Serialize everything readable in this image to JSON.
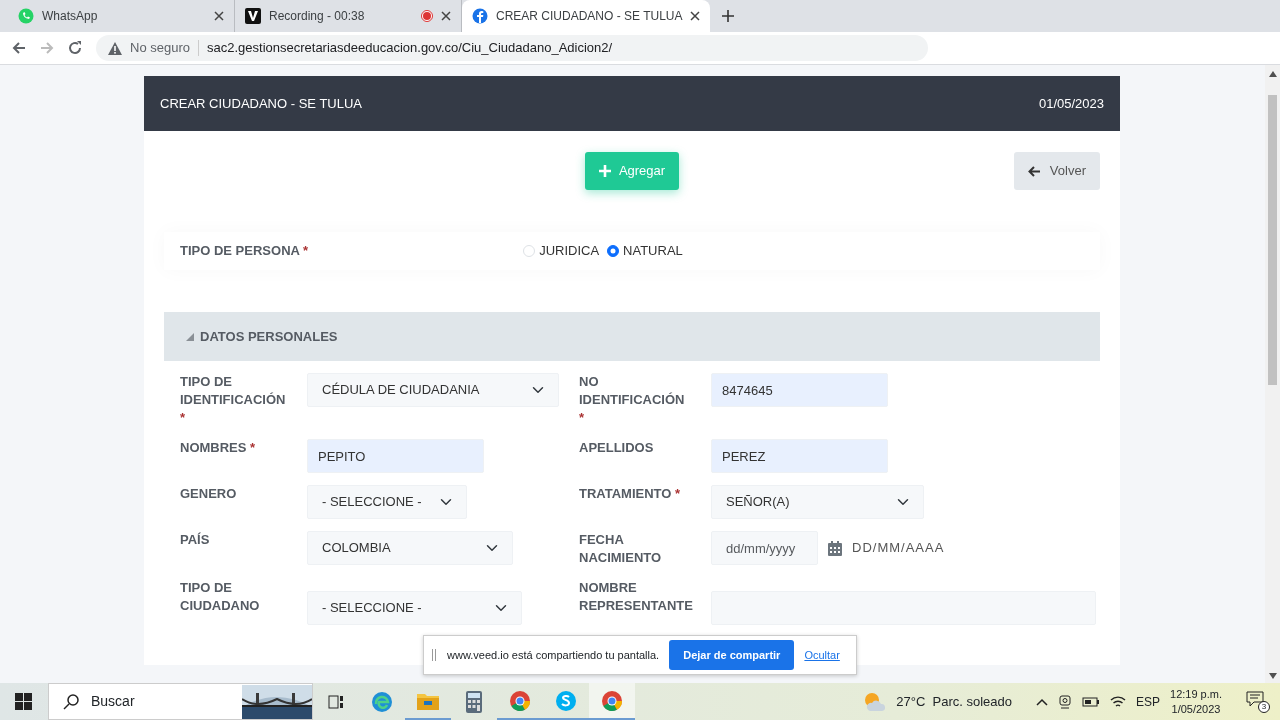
{
  "browser": {
    "tabs": [
      {
        "label": "WhatsApp",
        "selected": false,
        "kind": "whatsapp",
        "recording": false
      },
      {
        "label": "Recording - 00:38",
        "selected": false,
        "kind": "v",
        "recording": true
      },
      {
        "label": "CREAR CIUDADANO - SE TULUA",
        "selected": true,
        "kind": "site",
        "recording": false
      }
    ],
    "security": "No seguro",
    "url": "sac2.gestionsecretariasdeeducacion.gov.co/Ciu_Ciudadano_Adicion2/"
  },
  "header": {
    "title": "CREAR CIUDADANO - SE TULUA",
    "date": "01/05/2023"
  },
  "buttons": {
    "add": "Agregar",
    "back": "Volver"
  },
  "persona": {
    "label": "TIPO DE PERSONA",
    "required_mark": "*",
    "options": [
      {
        "label": "JURIDICA",
        "selected": false
      },
      {
        "label": "NATURAL",
        "selected": true
      }
    ]
  },
  "section": {
    "title": "DATOS PERSONALES",
    "expanded": true
  },
  "fields": [
    {
      "label": "TIPO DE IDENTIFICACIÓN",
      "required_mark": "*",
      "kind": "select",
      "value": "CÉDULA DE CIUDADANIA"
    },
    {
      "label": "NO IDENTIFICACIÓN",
      "required_mark": "*",
      "kind": "input",
      "value": "8474645",
      "filled": true
    },
    {
      "label": "NOMBRES",
      "required_mark": "*",
      "kind": "input",
      "value": "PEPITO",
      "filled": true
    },
    {
      "label": "APELLIDOS",
      "kind": "input",
      "value": "PEREZ",
      "filled": true
    },
    {
      "label": "GENERO",
      "kind": "select",
      "value": "- SELECCIONE -"
    },
    {
      "label": "TRATAMIENTO",
      "required_mark": "*",
      "kind": "select",
      "value": "SEÑOR(A)"
    },
    {
      "label": "PAÍS",
      "kind": "select",
      "value": "COLOMBIA"
    },
    {
      "label": "FECHA NACIMIENTO",
      "kind": "date",
      "placeholder": "dd/mm/yyyy",
      "hint": "DD/MM/AAAA"
    },
    {
      "label": "TIPO DE CIUDADANO",
      "kind": "select",
      "value": "- SELECCIONE -"
    },
    {
      "label": "NOMBRE REPRESENTANTE",
      "kind": "input",
      "filled": false
    }
  ],
  "share_bar": {
    "text": "www.veed.io está compartiendo tu pantalla.",
    "stop": "Dejar de compartir",
    "hide": "Ocultar"
  },
  "taskbar": {
    "search": "Buscar",
    "weather": "27°C  Parc. soleado",
    "language": "ESP",
    "time": "12:19 p.m.",
    "date": "1/05/2023",
    "notifications": "3"
  }
}
